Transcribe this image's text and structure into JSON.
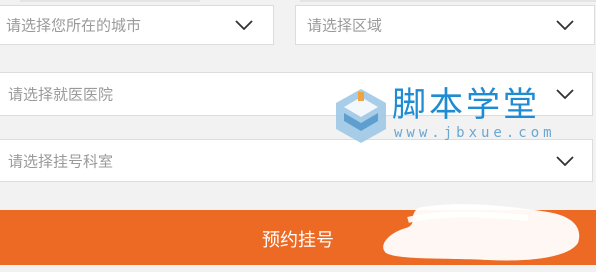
{
  "form": {
    "city_placeholder": "请选择您所在的城市",
    "district_placeholder": "请选择区域",
    "hospital_placeholder": "请选择就医医院",
    "department_placeholder": "请选择挂号科室",
    "submit_label": "预约挂号"
  },
  "watermark": {
    "title": "脚本学堂",
    "url": "www.jbxue.com"
  },
  "colors": {
    "accent": "#ec6a24",
    "placeholder": "#9a9a9a",
    "border": "#dcdcdc",
    "watermark": "#1e8bd2"
  },
  "icons": {
    "select_arrow": "chevron-down-icon",
    "watermark_logo": "jbxue-logo-icon"
  }
}
